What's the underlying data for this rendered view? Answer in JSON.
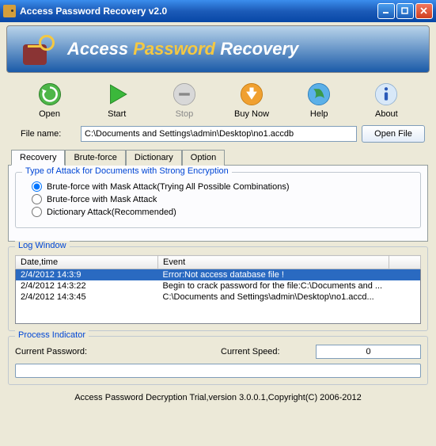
{
  "window": {
    "title": "Access Password Recovery v2.0"
  },
  "banner": {
    "text_prefix": "Access ",
    "text_accent": "Password",
    "text_suffix": " Recovery"
  },
  "toolbar": {
    "open": "Open",
    "start": "Start",
    "stop": "Stop",
    "buynow": "Buy Now",
    "help": "Help",
    "about": "About"
  },
  "file": {
    "label": "File name:",
    "value": "C:\\Documents and Settings\\admin\\Desktop\\no1.accdb",
    "open_btn": "Open File"
  },
  "tabs": {
    "recovery": "Recovery",
    "bruteforce": "Brute-force",
    "dictionary": "Dictionary",
    "option": "Option"
  },
  "attack": {
    "legend": "Type of Attack for Documents with Strong Encryption",
    "opt1": "Brute-force with Mask Attack(Trying All Possible Combinations)",
    "opt2": "Brute-force with Mask Attack",
    "opt3": "Dictionary Attack(Recommended)"
  },
  "log": {
    "legend": "Log Window",
    "col_datetime": "Date,time",
    "col_event": "Event",
    "rows": [
      {
        "dt": "2/4/2012 14:3:9",
        "ev": "Error:Not access database file !"
      },
      {
        "dt": "2/4/2012 14:3:22",
        "ev": "Begin to crack password for the file:C:\\Documents and ..."
      },
      {
        "dt": "2/4/2012 14:3:45",
        "ev": "C:\\Documents and Settings\\admin\\Desktop\\no1.accd..."
      }
    ]
  },
  "process": {
    "legend": "Process Indicator",
    "cur_pwd_label": "Current Password:",
    "cur_speed_label": "Current Speed:",
    "speed_value": "0"
  },
  "footer": {
    "text": "Access Password Decryption Trial,version 3.0.0.1,Copyright(C) 2006-2012"
  }
}
